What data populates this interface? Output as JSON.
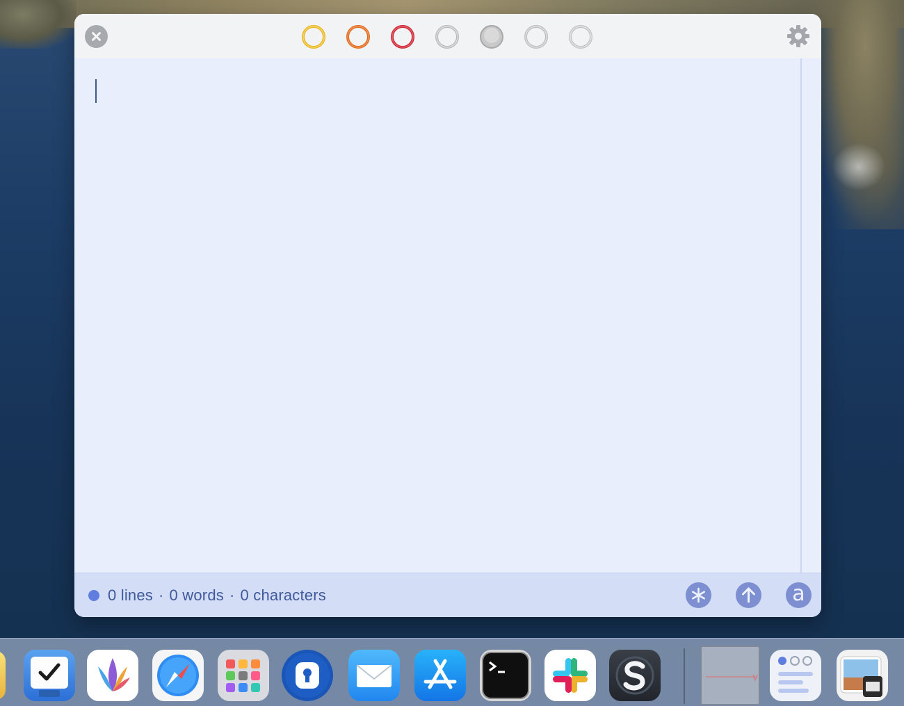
{
  "window": {
    "status": {
      "lines": "0 lines",
      "words": "0 words",
      "characters": "0 characters",
      "separator": "·"
    },
    "swatches": [
      {
        "name": "yellow",
        "color": "#e9b21f"
      },
      {
        "name": "orange",
        "color": "#df6a1c"
      },
      {
        "name": "red",
        "color": "#cc2836"
      },
      {
        "name": "gray-1",
        "color": "#b9b9b9"
      },
      {
        "name": "gray-2-selected",
        "color": "#a8a8a8"
      },
      {
        "name": "gray-3",
        "color": "#bdbdbd"
      },
      {
        "name": "gray-4",
        "color": "#c2c2c2"
      }
    ],
    "icons": {
      "close": "close-icon",
      "settings": "gear-icon",
      "markdown": "asterisk-icon",
      "share": "arrow-up-icon",
      "font": "letter-a-icon"
    },
    "font_button_glyph": "a"
  },
  "dock": {
    "items": [
      "partial-app-icon",
      "tasks-app-icon",
      "vector-app-icon",
      "safari-icon",
      "launchpad-icon",
      "password-manager-icon",
      "mail-icon",
      "app-store-icon",
      "terminal-icon",
      "slack-icon",
      "scrivener-icon",
      "document-preview-icon",
      "window-app-icon",
      "preview-icon"
    ]
  }
}
